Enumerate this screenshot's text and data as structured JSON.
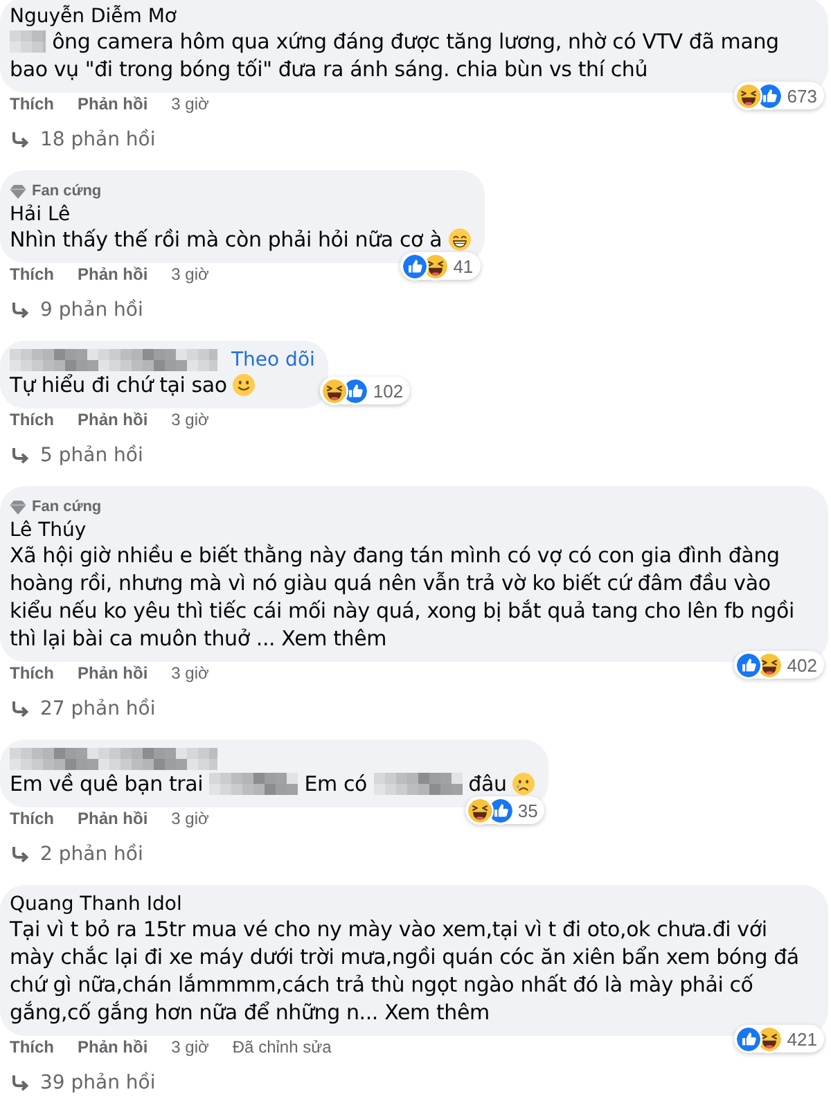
{
  "comments": [
    {
      "author": {
        "kind": "name",
        "text": "Nguyễn Diễm Mơ"
      },
      "body": [
        {
          "kind": "redacted_word"
        },
        {
          "kind": "text",
          "text": "ông camera hôm qua xứng đáng được tăng lương, nhờ có VTV đã mang bao vụ \"đi trong bóng tối\" đưa ra ánh sáng. chia bùn vs thí chủ"
        }
      ],
      "reactions": [
        {
          "kind": "haha"
        },
        {
          "kind": "like"
        }
      ],
      "reaction_count": "673",
      "actions": [
        {
          "kind": "link",
          "text": "Thích"
        },
        {
          "kind": "link",
          "text": "Phản hồi"
        },
        {
          "kind": "time",
          "text": "3 giờ"
        }
      ],
      "replies": "18 phản hồi"
    },
    {
      "badge": "Fan cứng",
      "author": {
        "kind": "name",
        "text": "Hải Lê"
      },
      "body": [
        {
          "kind": "text",
          "text": "Nhìn thấy thế rồi mà còn phải hỏi nữa cơ à"
        },
        {
          "kind": "emoji_grin"
        }
      ],
      "reactions": [
        {
          "kind": "like"
        },
        {
          "kind": "haha"
        }
      ],
      "reaction_count": "41",
      "actions": [
        {
          "kind": "link",
          "text": "Thích"
        },
        {
          "kind": "link",
          "text": "Phản hồi"
        },
        {
          "kind": "time",
          "text": "3 giờ"
        }
      ],
      "replies": "9 phản hồi"
    },
    {
      "author": {
        "kind": "redacted"
      },
      "follow": "Theo dõi",
      "body": [
        {
          "kind": "text",
          "text": "Tự hiểu đi chứ tại sao"
        },
        {
          "kind": "emoji_smile"
        }
      ],
      "reactions": [
        {
          "kind": "haha"
        },
        {
          "kind": "like"
        }
      ],
      "reaction_count": "102",
      "actions": [
        {
          "kind": "link",
          "text": "Thích"
        },
        {
          "kind": "link",
          "text": "Phản hồi"
        },
        {
          "kind": "time",
          "text": "3 giờ"
        }
      ],
      "replies": "5 phản hồi"
    },
    {
      "badge": "Fan cứng",
      "author": {
        "kind": "name",
        "text": "Lê Thúy"
      },
      "body": [
        {
          "kind": "text",
          "text": "Xã hội giờ nhiều e biết thằng này đang tán mình có vợ có con gia đình đàng hoàng rồi, nhưng mà vì nó giàu quá nên vẫn trả vờ ko biết cứ đâm đầu vào kiểu nếu ko yêu thì tiếc cái mối này quá, xong bị bắt quả tang cho lên fb ngồi thì lại bài ca muôn thuở ..."
        }
      ],
      "see_more": "Xem thêm",
      "reactions": [
        {
          "kind": "like"
        },
        {
          "kind": "haha"
        }
      ],
      "reaction_count": "402",
      "actions": [
        {
          "kind": "link",
          "text": "Thích"
        },
        {
          "kind": "link",
          "text": "Phản hồi"
        },
        {
          "kind": "time",
          "text": "3 giờ"
        }
      ],
      "replies": "27 phản hồi"
    },
    {
      "author": {
        "kind": "redacted"
      },
      "body": [
        {
          "kind": "text",
          "text": "Em về quê bạn trai"
        },
        {
          "kind": "redacted_phrase"
        },
        {
          "kind": "text",
          "text": "Em có"
        },
        {
          "kind": "redacted_phrase"
        },
        {
          "kind": "text",
          "text": "đâu"
        },
        {
          "kind": "emoji_sad"
        }
      ],
      "reactions": [
        {
          "kind": "haha"
        },
        {
          "kind": "like"
        }
      ],
      "reaction_count": "35",
      "actions": [
        {
          "kind": "link",
          "text": "Thích"
        },
        {
          "kind": "link",
          "text": "Phản hồi"
        },
        {
          "kind": "time",
          "text": "3 giờ"
        }
      ],
      "replies": "2 phản hồi"
    },
    {
      "author": {
        "kind": "name",
        "text": "Quang Thanh Idol"
      },
      "body": [
        {
          "kind": "text",
          "text": "Tại vì t bỏ ra 15tr mua vé cho ny mày vào xem,tại vì t đi oto,ok chưa.đi với mày chắc lại đi xe máy dưới trời mưa,ngồi quán cóc ăn xiên bẩn xem bóng đá chứ gì nữa,chán lắmmmm,cách trả thù ngọt ngào nhất đó là mày phải cố gắng,cố gắng hơn nữa để những n..."
        }
      ],
      "see_more": "Xem thêm",
      "reactions": [
        {
          "kind": "like"
        },
        {
          "kind": "haha"
        }
      ],
      "reaction_count": "421",
      "actions": [
        {
          "kind": "link",
          "text": "Thích"
        },
        {
          "kind": "link",
          "text": "Phản hồi"
        },
        {
          "kind": "time",
          "text": "3 giờ"
        },
        {
          "kind": "note",
          "text": "Đã chỉnh sửa"
        }
      ],
      "replies": "39 phản hồi"
    }
  ]
}
